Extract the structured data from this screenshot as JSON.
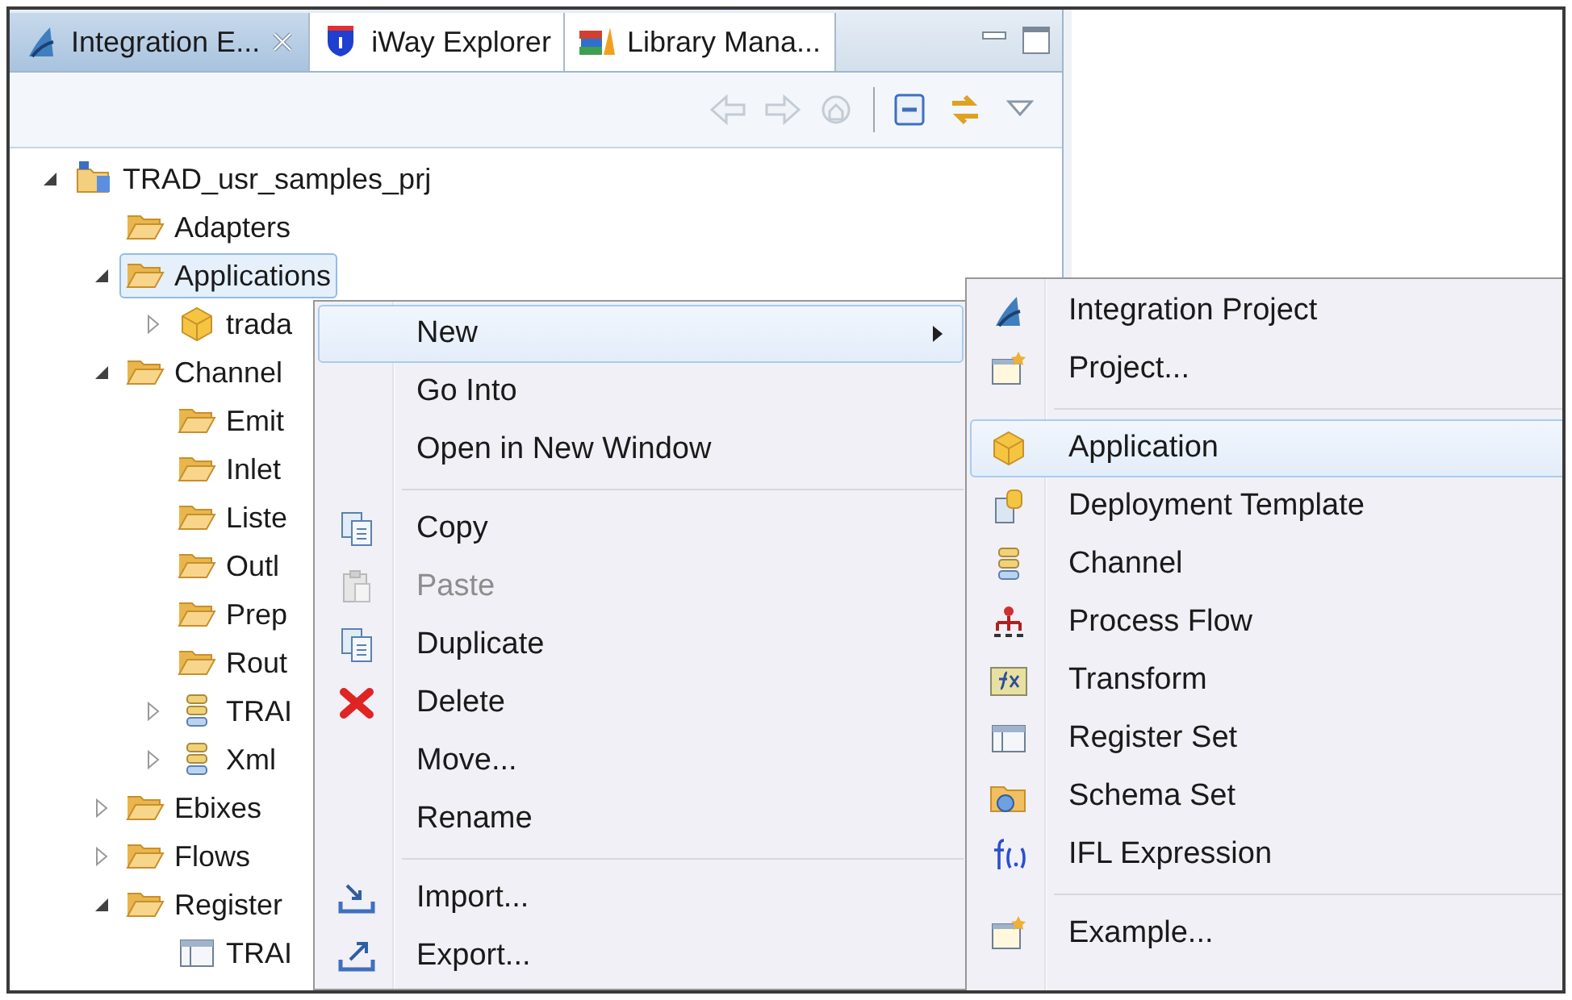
{
  "tabs": [
    {
      "label": "Integration E...",
      "selected": true,
      "kind": "integration",
      "closable": true
    },
    {
      "label": "iWay Explorer",
      "selected": false,
      "kind": "shield",
      "closable": false
    },
    {
      "label": "Library Mana...",
      "selected": false,
      "kind": "books",
      "closable": false
    }
  ],
  "toolbar": {
    "buttons": [
      {
        "kind": "back",
        "disabled": true
      },
      {
        "kind": "forward",
        "disabled": true
      },
      {
        "kind": "home",
        "disabled": true
      },
      {
        "kind": "collapse",
        "disabled": false
      },
      {
        "kind": "link",
        "disabled": false
      },
      {
        "kind": "viewmenu",
        "disabled": false
      }
    ]
  },
  "tree": {
    "items": [
      {
        "label": "TRAD_usr_samples_prj",
        "kind": "project",
        "selected": false,
        "expanded": true,
        "children": [
          {
            "label": "Adapters",
            "kind": "folder",
            "selected": false
          },
          {
            "label": "Applications",
            "kind": "folder",
            "selected": true,
            "expanded": true,
            "children": [
              {
                "label": "trada",
                "kind": "application",
                "selected": false,
                "expanded": false
              }
            ]
          },
          {
            "label": "Channel",
            "kind": "folder",
            "selected": false,
            "expanded": true,
            "children": [
              {
                "label": "Emit",
                "kind": "folder",
                "selected": false
              },
              {
                "label": "Inlet",
                "kind": "folder",
                "selected": false
              },
              {
                "label": "Liste",
                "kind": "folder",
                "selected": false
              },
              {
                "label": "Outl",
                "kind": "folder",
                "selected": false
              },
              {
                "label": "Prep",
                "kind": "folder",
                "selected": false
              },
              {
                "label": "Rout",
                "kind": "folder",
                "selected": false
              },
              {
                "label": "TRAI",
                "kind": "channel",
                "selected": false,
                "expanded": false
              },
              {
                "label": "Xml",
                "kind": "channel",
                "selected": false,
                "expanded": false
              }
            ]
          },
          {
            "label": "Ebixes",
            "kind": "folder",
            "selected": false,
            "expanded": false
          },
          {
            "label": "Flows",
            "kind": "folder",
            "selected": false,
            "expanded": false
          },
          {
            "label": "Register",
            "kind": "folder",
            "selected": false,
            "expanded": true,
            "children": [
              {
                "label": "TRAI",
                "kind": "register",
                "selected": false
              }
            ]
          }
        ]
      }
    ]
  },
  "context_menu": {
    "items": [
      {
        "label": "New",
        "kind": "plain",
        "selected": true,
        "disabled": false,
        "submenu": true
      },
      {
        "label": "Go Into",
        "kind": "plain",
        "selected": false,
        "disabled": false,
        "submenu": false
      },
      {
        "label": "Open in New Window",
        "kind": "plain",
        "selected": false,
        "disabled": false,
        "submenu": false
      },
      {
        "kind": "separator"
      },
      {
        "label": "Copy",
        "kind": "copy",
        "selected": false,
        "disabled": false,
        "submenu": false
      },
      {
        "label": "Paste",
        "kind": "paste",
        "selected": false,
        "disabled": true,
        "submenu": false
      },
      {
        "label": "Duplicate",
        "kind": "copy",
        "selected": false,
        "disabled": false,
        "submenu": false
      },
      {
        "label": "Delete",
        "kind": "delete",
        "selected": false,
        "disabled": false,
        "submenu": false
      },
      {
        "label": "Move...",
        "kind": "plain",
        "selected": false,
        "disabled": false,
        "submenu": false
      },
      {
        "label": "Rename",
        "kind": "plain",
        "selected": false,
        "disabled": false,
        "submenu": false
      },
      {
        "kind": "separator"
      },
      {
        "label": "Import...",
        "kind": "import",
        "selected": false,
        "disabled": false,
        "submenu": false
      },
      {
        "label": "Export...",
        "kind": "export",
        "selected": false,
        "disabled": false,
        "submenu": false
      }
    ]
  },
  "submenu": {
    "items": [
      {
        "label": "Integration Project",
        "kind": "integration",
        "selected": false,
        "disabled": false,
        "submenu": false
      },
      {
        "label": "Project...",
        "kind": "newproject",
        "selected": false,
        "disabled": false,
        "submenu": false
      },
      {
        "kind": "separator"
      },
      {
        "label": "Application",
        "kind": "application",
        "selected": true,
        "disabled": false,
        "submenu": false
      },
      {
        "label": "Deployment Template",
        "kind": "template",
        "selected": false,
        "disabled": false,
        "submenu": false
      },
      {
        "label": "Channel",
        "kind": "channel",
        "selected": false,
        "disabled": false,
        "submenu": false
      },
      {
        "label": "Process Flow",
        "kind": "flow",
        "selected": false,
        "disabled": false,
        "submenu": false
      },
      {
        "label": "Transform",
        "kind": "transform",
        "selected": false,
        "disabled": false,
        "submenu": false
      },
      {
        "label": "Register Set",
        "kind": "register",
        "selected": false,
        "disabled": false,
        "submenu": false
      },
      {
        "label": "Schema Set",
        "kind": "schema",
        "selected": false,
        "disabled": false,
        "submenu": false
      },
      {
        "label": "IFL Expression",
        "kind": "expression",
        "selected": false,
        "disabled": false,
        "submenu": false
      },
      {
        "kind": "separator"
      },
      {
        "label": "Example...",
        "kind": "newproject",
        "selected": false,
        "disabled": false,
        "submenu": false
      }
    ]
  }
}
